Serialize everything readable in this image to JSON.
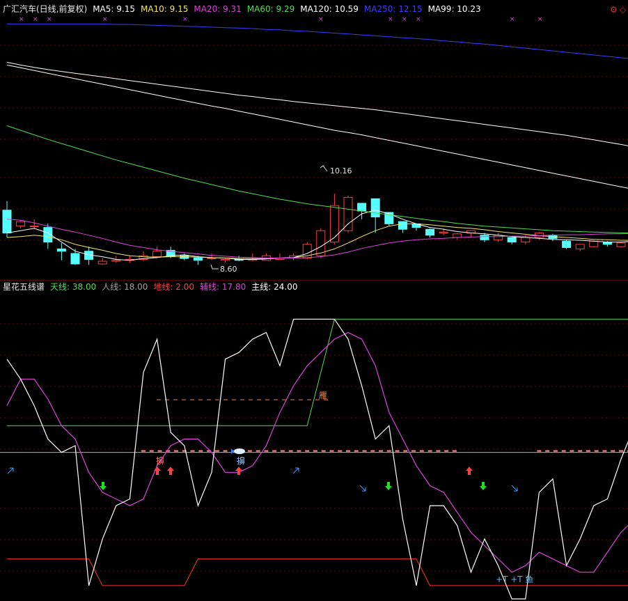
{
  "window": {
    "corner_icons": [
      {
        "name": "settings-icon",
        "glyph": "⚙",
        "color": "#cc3333"
      },
      {
        "name": "diamond-icon",
        "glyph": "◇",
        "color": "#cc3333"
      }
    ]
  },
  "main_header": [
    {
      "text": "广汇汽车(日线,前复权)",
      "color": "#e8e8e8"
    },
    {
      "text": "MA5: 9.15",
      "color": "#ffffff"
    },
    {
      "text": "MA10: 9.15",
      "color": "#f5e663"
    },
    {
      "text": "MA20: 9.31",
      "color": "#e040e0"
    },
    {
      "text": "MA60: 9.29",
      "color": "#4cdf4c"
    },
    {
      "text": "MA120: 10.59",
      "color": "#ffffff"
    },
    {
      "text": "MA250: 12.15",
      "color": "#3b3bff"
    },
    {
      "text": "MA99: 10.23",
      "color": "#ffffff"
    }
  ],
  "price_marks": {
    "high": "10.16",
    "low": "8.60"
  },
  "sub_header": [
    {
      "text": "星花五线谱",
      "color": "#e8e8e8"
    },
    {
      "text": "天线: 38.00",
      "color": "#4cdf4c"
    },
    {
      "text": "人线: 18.00",
      "color": "#a0a0a0"
    },
    {
      "text": "地线: 2.00",
      "color": "#ff4040"
    },
    {
      "text": "辅线: 17.80",
      "color": "#e040e0"
    },
    {
      "text": "主线: 24.00",
      "color": "#ffffff"
    }
  ],
  "sub_labels": {
    "yan": "雁",
    "dao1": "擤",
    "dao2": "擤",
    "yu": "+T +T 鱼"
  },
  "chart_data": {
    "type": "line",
    "candles": {
      "o": [
        9.8,
        9.45,
        9.44,
        9.42,
        8.95,
        8.85,
        8.9,
        8.62,
        8.68,
        8.7,
        8.72,
        8.78,
        8.92,
        8.8,
        8.75,
        8.75,
        8.7,
        8.72,
        8.7,
        8.7,
        8.72,
        8.75,
        8.75,
        8.8,
        9.1,
        9.35,
        9.95,
        10.05,
        9.75,
        9.55,
        9.5,
        9.38,
        9.3,
        9.2,
        9.3,
        9.25,
        9.15,
        9.2,
        9.1,
        9.2,
        9.25,
        9.12,
        8.95,
        9.0,
        9.1,
        9.0,
        9.05,
        9.12,
        9.18
      ],
      "c": [
        9.3,
        9.55,
        9.45,
        9.1,
        8.9,
        8.62,
        8.72,
        8.68,
        8.7,
        8.72,
        8.8,
        8.9,
        8.78,
        8.74,
        8.7,
        8.75,
        8.72,
        8.7,
        8.72,
        8.8,
        8.75,
        8.8,
        9.05,
        9.35,
        9.9,
        10.08,
        9.78,
        9.65,
        9.5,
        9.38,
        9.42,
        9.25,
        9.32,
        9.28,
        9.35,
        9.15,
        9.25,
        9.1,
        9.2,
        9.3,
        9.18,
        8.98,
        9.05,
        9.12,
        9.05,
        9.08,
        9.14,
        9.16,
        9.2
      ],
      "h": [
        10.0,
        9.58,
        9.6,
        9.5,
        9.08,
        8.95,
        9.0,
        8.75,
        8.8,
        8.8,
        8.9,
        9.0,
        9.0,
        8.85,
        8.8,
        8.85,
        8.75,
        8.8,
        8.85,
        8.85,
        8.85,
        8.85,
        9.1,
        9.4,
        10.16,
        10.12,
        9.85,
        9.9,
        9.6,
        9.55,
        9.5,
        9.4,
        9.4,
        9.3,
        9.35,
        9.3,
        9.3,
        9.2,
        9.25,
        9.32,
        9.28,
        9.15,
        9.05,
        9.12,
        9.12,
        9.1,
        9.15,
        9.22,
        9.25
      ],
      "l": [
        9.2,
        9.4,
        9.4,
        8.95,
        8.7,
        8.6,
        8.6,
        8.6,
        8.65,
        8.65,
        8.68,
        8.75,
        8.75,
        8.7,
        8.6,
        8.7,
        8.65,
        8.68,
        8.68,
        8.7,
        8.72,
        8.7,
        8.72,
        8.75,
        9.05,
        9.3,
        9.6,
        9.3,
        9.45,
        9.3,
        9.35,
        9.2,
        9.25,
        9.15,
        9.2,
        9.1,
        9.1,
        9.05,
        9.05,
        9.15,
        9.12,
        8.95,
        8.9,
        8.98,
        9.0,
        8.98,
        9.0,
        9.1,
        9.12
      ]
    },
    "mas": [
      {
        "name": "MA5",
        "values": [
          9.3,
          9.35,
          9.4,
          9.3,
          9.1,
          8.9,
          8.82,
          8.78,
          8.72,
          8.7,
          8.74,
          8.76,
          8.8,
          8.82,
          8.78,
          8.76,
          8.75,
          8.72,
          8.72,
          8.73,
          8.75,
          8.76,
          8.85,
          9.0,
          9.2,
          9.5,
          9.72,
          9.8,
          9.72,
          9.6,
          9.5,
          9.42,
          9.38,
          9.33,
          9.3,
          9.28,
          9.25,
          9.22,
          9.2,
          9.18,
          9.16,
          9.15,
          9.14,
          9.12,
          9.1,
          9.1,
          9.12,
          9.14,
          9.15
        ]
      },
      {
        "name": "MA10",
        "values": [
          9.2,
          9.22,
          9.25,
          9.22,
          9.15,
          9.05,
          8.98,
          8.92,
          8.85,
          8.8,
          8.78,
          8.77,
          8.78,
          8.78,
          8.77,
          8.76,
          8.75,
          8.74,
          8.74,
          8.74,
          8.75,
          8.76,
          8.8,
          8.86,
          8.95,
          9.08,
          9.22,
          9.35,
          9.45,
          9.5,
          9.5,
          9.48,
          9.45,
          9.42,
          9.4,
          9.37,
          9.33,
          9.3,
          9.27,
          9.24,
          9.22,
          9.2,
          9.18,
          9.16,
          9.15,
          9.14,
          9.14,
          9.15,
          9.15
        ]
      },
      {
        "name": "MA20",
        "values": [
          9.6,
          9.58,
          9.52,
          9.45,
          9.38,
          9.32,
          9.25,
          9.18,
          9.1,
          9.03,
          8.98,
          8.93,
          8.9,
          8.87,
          8.84,
          8.81,
          8.79,
          8.77,
          8.76,
          8.75,
          8.75,
          8.75,
          8.76,
          8.78,
          8.82,
          8.88,
          8.96,
          9.02,
          9.08,
          9.12,
          9.15,
          9.17,
          9.18,
          9.2,
          9.21,
          9.22,
          9.22,
          9.23,
          9.23,
          9.24,
          9.25,
          9.26,
          9.26,
          9.27,
          9.28,
          9.28,
          9.29,
          9.3,
          9.31
        ]
      },
      {
        "name": "MA60",
        "values": [
          11.65,
          11.55,
          11.45,
          11.35,
          11.26,
          11.17,
          11.08,
          10.99,
          10.9,
          10.82,
          10.74,
          10.66,
          10.58,
          10.5,
          10.43,
          10.36,
          10.29,
          10.22,
          10.16,
          10.1,
          10.04,
          9.99,
          9.94,
          9.9,
          9.86,
          9.82,
          9.78,
          9.74,
          9.7,
          9.66,
          9.62,
          9.58,
          9.55,
          9.51,
          9.48,
          9.45,
          9.43,
          9.41,
          9.39,
          9.37,
          9.35,
          9.34,
          9.33,
          9.32,
          9.31,
          9.3,
          9.3,
          9.29,
          9.29
        ]
      },
      {
        "name": "MA120",
        "values": [
          13.04,
          12.98,
          12.93,
          12.88,
          12.84,
          12.8,
          12.76,
          12.72,
          12.68,
          12.64,
          12.6,
          12.56,
          12.52,
          12.48,
          12.44,
          12.4,
          12.36,
          12.32,
          12.29,
          12.25,
          12.22,
          12.18,
          12.15,
          12.12,
          12.09,
          12.06,
          12.03,
          12.0,
          11.96,
          11.92,
          11.88,
          11.84,
          11.8,
          11.76,
          11.72,
          11.68,
          11.64,
          11.6,
          11.56,
          11.52,
          11.48,
          11.44,
          11.39,
          11.34,
          11.29,
          11.24,
          11.18,
          11.13,
          11.08
        ]
      },
      {
        "name": "MA99",
        "values": [
          12.98,
          12.92,
          12.86,
          12.8,
          12.74,
          12.68,
          12.62,
          12.56,
          12.5,
          12.44,
          12.38,
          12.32,
          12.26,
          12.2,
          12.14,
          12.08,
          12.03,
          11.97,
          11.91,
          11.85,
          11.79,
          11.73,
          11.67,
          11.61,
          11.55,
          11.5,
          11.45,
          11.39,
          11.33,
          11.27,
          11.21,
          11.15,
          11.09,
          11.03,
          10.97,
          10.91,
          10.85,
          10.79,
          10.73,
          10.67,
          10.61,
          10.55,
          10.49,
          10.43,
          10.37,
          10.31,
          10.25,
          10.2,
          10.16
        ]
      },
      {
        "name": "MA250",
        "values": [
          13.88,
          13.88,
          13.88,
          13.88,
          13.88,
          13.88,
          13.88,
          13.88,
          13.87,
          13.87,
          13.86,
          13.85,
          13.84,
          13.83,
          13.82,
          13.81,
          13.8,
          13.79,
          13.78,
          13.76,
          13.75,
          13.73,
          13.72,
          13.7,
          13.68,
          13.66,
          13.64,
          13.62,
          13.6,
          13.58,
          13.56,
          13.54,
          13.51,
          13.49,
          13.46,
          13.44,
          13.41,
          13.38,
          13.35,
          13.32,
          13.29,
          13.26,
          13.23,
          13.2,
          13.17,
          13.14,
          13.11,
          13.08,
          13.05
        ]
      }
    ],
    "price_range": [
      8.3,
      14.1
    ],
    "indicator": {
      "range": [
        -4,
        42
      ],
      "tianxian": [
        [
          0,
          22
        ],
        [
          22,
          22
        ],
        [
          24,
          38
        ],
        [
          49,
          38
        ]
      ],
      "dixian": [
        [
          0,
          2
        ],
        [
          6,
          2
        ],
        [
          7,
          -2
        ],
        [
          13,
          -2
        ],
        [
          14,
          2
        ],
        [
          30,
          2
        ],
        [
          31,
          -2
        ],
        [
          49,
          -2
        ]
      ],
      "renxian_level": 18,
      "renxian_marks": [
        [
          10,
          33
        ],
        [
          39,
          49
        ]
      ],
      "zhuxian": [
        32,
        29,
        25,
        20,
        18,
        19,
        -2,
        5,
        10,
        11,
        30,
        35,
        21,
        19,
        10,
        15,
        32,
        33,
        35,
        36,
        31,
        38,
        38,
        38,
        38,
        35,
        28,
        20,
        22,
        8,
        -2,
        10,
        10,
        7,
        0,
        5,
        1,
        -4,
        -4,
        12,
        14,
        1,
        5,
        10,
        11,
        17,
        22,
        23,
        25
      ],
      "fuxian": [
        25,
        29,
        29,
        26,
        22,
        20,
        15,
        12,
        11,
        10,
        11,
        16,
        19,
        20,
        20,
        18,
        15,
        15,
        16,
        19,
        24,
        28,
        31,
        33,
        35,
        36,
        35,
        31,
        24,
        20,
        16,
        13,
        12,
        9,
        6,
        4,
        2,
        0,
        1,
        3,
        2,
        1,
        0,
        0,
        3,
        6,
        8,
        12,
        14
      ]
    }
  }
}
